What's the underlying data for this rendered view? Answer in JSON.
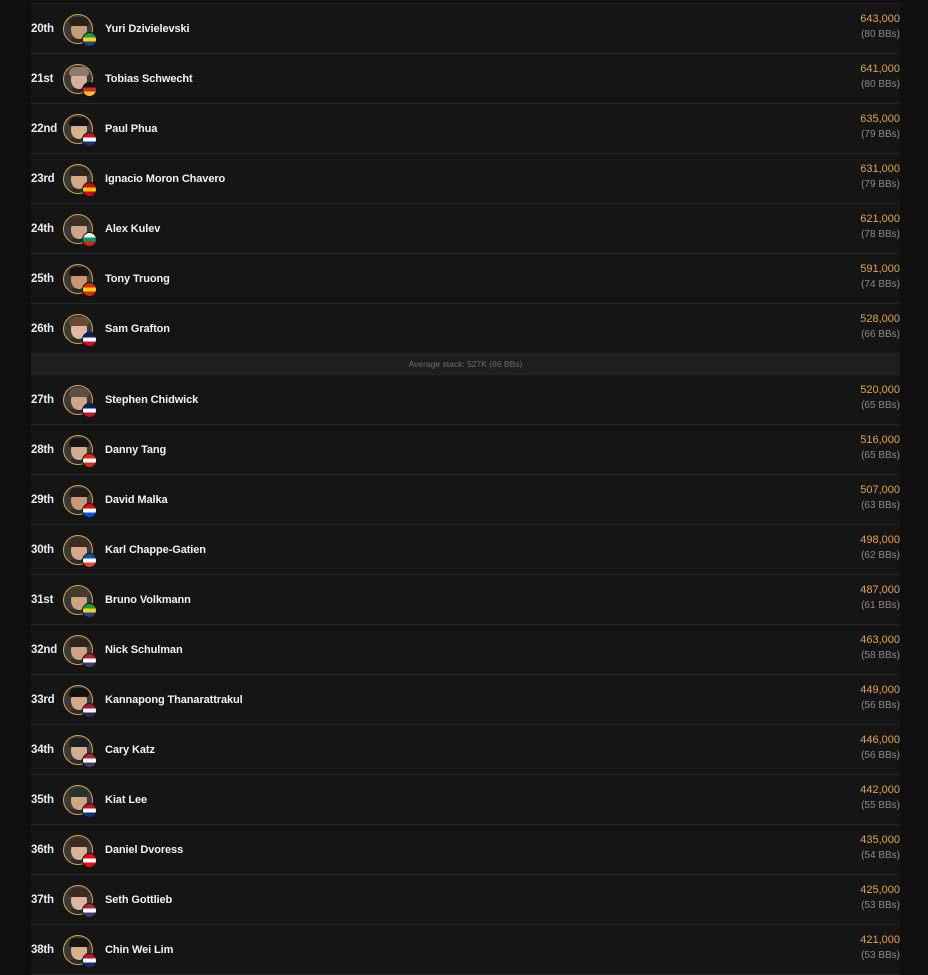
{
  "leaderboard": {
    "rows_before": [
      {
        "rank": "20th",
        "name": "Yuri Dzivielevski",
        "chips": "643,000",
        "bbs": "(80 BBs)",
        "flag": "brazil-flag-icon",
        "flag_colors": [
          "#1e9b3b",
          "#f4d21c",
          "#233f8e"
        ],
        "skin": "#c79a78",
        "hair": "#2a1f19"
      },
      {
        "rank": "21st",
        "name": "Tobias Schwecht",
        "chips": "641,000",
        "bbs": "(80 BBs)",
        "flag": "germany-flag-icon",
        "flag_colors": [
          "#111111",
          "#d62828",
          "#f4c21c"
        ],
        "skin": "#d8b09a",
        "hair": "#8c7b6d"
      },
      {
        "rank": "22nd",
        "name": "Paul Phua",
        "chips": "635,000",
        "bbs": "(79 BBs)",
        "flag": "malaysia-flag-icon",
        "flag_colors": [
          "#c8102e",
          "#ffffff",
          "#10307a"
        ],
        "skin": "#d9b18a",
        "hair": "#141414"
      },
      {
        "rank": "23rd",
        "name": "Ignacio Moron Chavero",
        "chips": "631,000",
        "bbs": "(79 BBs)",
        "flag": "spain-flag-icon",
        "flag_colors": [
          "#c60b1e",
          "#ffc400",
          "#c60b1e"
        ],
        "skin": "#d4a886",
        "hair": "#2b2320"
      },
      {
        "rank": "24th",
        "name": "Alex Kulev",
        "chips": "621,000",
        "bbs": "(78 BBs)",
        "flag": "bulgaria-flag-icon",
        "flag_colors": [
          "#ffffff",
          "#00966e",
          "#d62612"
        ],
        "skin": "#cfa58a",
        "hair": "#3a2e28"
      },
      {
        "rank": "25th",
        "name": "Tony Truong",
        "chips": "591,000",
        "bbs": "(74 BBs)",
        "flag": "vietnam-flag-icon",
        "flag_colors": [
          "#da251d",
          "#ffcd00",
          "#da251d"
        ],
        "skin": "#c99674",
        "hair": "#1a1414"
      },
      {
        "rank": "26th",
        "name": "Sam Grafton",
        "chips": "528,000",
        "bbs": "(66 BBs)",
        "flag": "uk-flag-icon",
        "flag_colors": [
          "#012169",
          "#ffffff",
          "#c8102e"
        ],
        "skin": "#e2b9a0",
        "hair": "#6a4a33"
      }
    ],
    "average_stack_text": "Average stack: 527K (66 BBs)",
    "rows_after": [
      {
        "rank": "27th",
        "name": "Stephen Chidwick",
        "chips": "520,000",
        "bbs": "(65 BBs)",
        "flag": "uk-flag-icon",
        "flag_colors": [
          "#012169",
          "#ffffff",
          "#c8102e"
        ],
        "skin": "#d1a58a",
        "hair": "#5a5048"
      },
      {
        "rank": "28th",
        "name": "Danny Tang",
        "chips": "516,000",
        "bbs": "(65 BBs)",
        "flag": "hong-kong-flag-icon",
        "flag_colors": [
          "#de2910",
          "#ffffff",
          "#de2910"
        ],
        "skin": "#d6ad8c",
        "hair": "#161616"
      },
      {
        "rank": "29th",
        "name": "David Malka",
        "chips": "507,000",
        "bbs": "(63 BBs)",
        "flag": "puerto-rico-flag-icon",
        "flag_colors": [
          "#ed0000",
          "#ffffff",
          "#0050f0"
        ],
        "skin": "#c9997a",
        "hair": "#231b17"
      },
      {
        "rank": "30th",
        "name": "Karl Chappe-Gatien",
        "chips": "498,000",
        "bbs": "(62 BBs)",
        "flag": "france-flag-icon",
        "flag_colors": [
          "#0055a4",
          "#ffffff",
          "#ef4135"
        ],
        "skin": "#d4a98d",
        "hair": "#3c2c23"
      },
      {
        "rank": "31st",
        "name": "Bruno Volkmann",
        "chips": "487,000",
        "bbs": "(61 BBs)",
        "flag": "brazil-flag-icon",
        "flag_colors": [
          "#1e9b3b",
          "#f4d21c",
          "#233f8e"
        ],
        "skin": "#cba383",
        "hair": "#4a3a2d"
      },
      {
        "rank": "32nd",
        "name": "Nick Schulman",
        "chips": "463,000",
        "bbs": "(58 BBs)",
        "flag": "usa-flag-icon",
        "flag_colors": [
          "#b22234",
          "#ffffff",
          "#3c3b6e"
        ],
        "skin": "#cfa383",
        "hair": "#2d2420"
      },
      {
        "rank": "33rd",
        "name": "Kannapong Thanarattrakul",
        "chips": "449,000",
        "bbs": "(56 BBs)",
        "flag": "thailand-flag-icon",
        "flag_colors": [
          "#a51931",
          "#f4f5f8",
          "#2d2a4a"
        ],
        "skin": "#d3aa88",
        "hair": "#111111"
      },
      {
        "rank": "34th",
        "name": "Cary Katz",
        "chips": "446,000",
        "bbs": "(56 BBs)",
        "flag": "usa-flag-icon",
        "flag_colors": [
          "#b22234",
          "#ffffff",
          "#3c3b6e"
        ],
        "skin": "#d6ad92",
        "hair": "#1f1f1f"
      },
      {
        "rank": "35th",
        "name": "Kiat Lee",
        "chips": "442,000",
        "bbs": "(55 BBs)",
        "flag": "malaysia-flag-icon",
        "flag_colors": [
          "#c8102e",
          "#ffffff",
          "#10307a"
        ],
        "skin": "#d0a684",
        "hair": "#23352a"
      },
      {
        "rank": "36th",
        "name": "Daniel Dvoress",
        "chips": "435,000",
        "bbs": "(54 BBs)",
        "flag": "canada-flag-icon",
        "flag_colors": [
          "#ff0000",
          "#ffffff",
          "#ff0000"
        ],
        "skin": "#d9b29a",
        "hair": "#3d2a22"
      },
      {
        "rank": "37th",
        "name": "Seth Gottlieb",
        "chips": "425,000",
        "bbs": "(53 BBs)",
        "flag": "usa-flag-icon",
        "flag_colors": [
          "#b22234",
          "#ffffff",
          "#3c3b6e"
        ],
        "skin": "#dcb79e",
        "hair": "#3a2a22"
      },
      {
        "rank": "38th",
        "name": "Chin Wei Lim",
        "chips": "421,000",
        "bbs": "(53 BBs)",
        "flag": "malaysia-flag-icon",
        "flag_colors": [
          "#c8102e",
          "#ffffff",
          "#10307a"
        ],
        "skin": "#d7b08e",
        "hair": "#151515"
      }
    ]
  },
  "colors": {
    "page_bg": "#0f0f0f",
    "panel_bg": "#151515",
    "accent_gold": "#e0a24a",
    "avatar_ring": "#d9a441"
  }
}
